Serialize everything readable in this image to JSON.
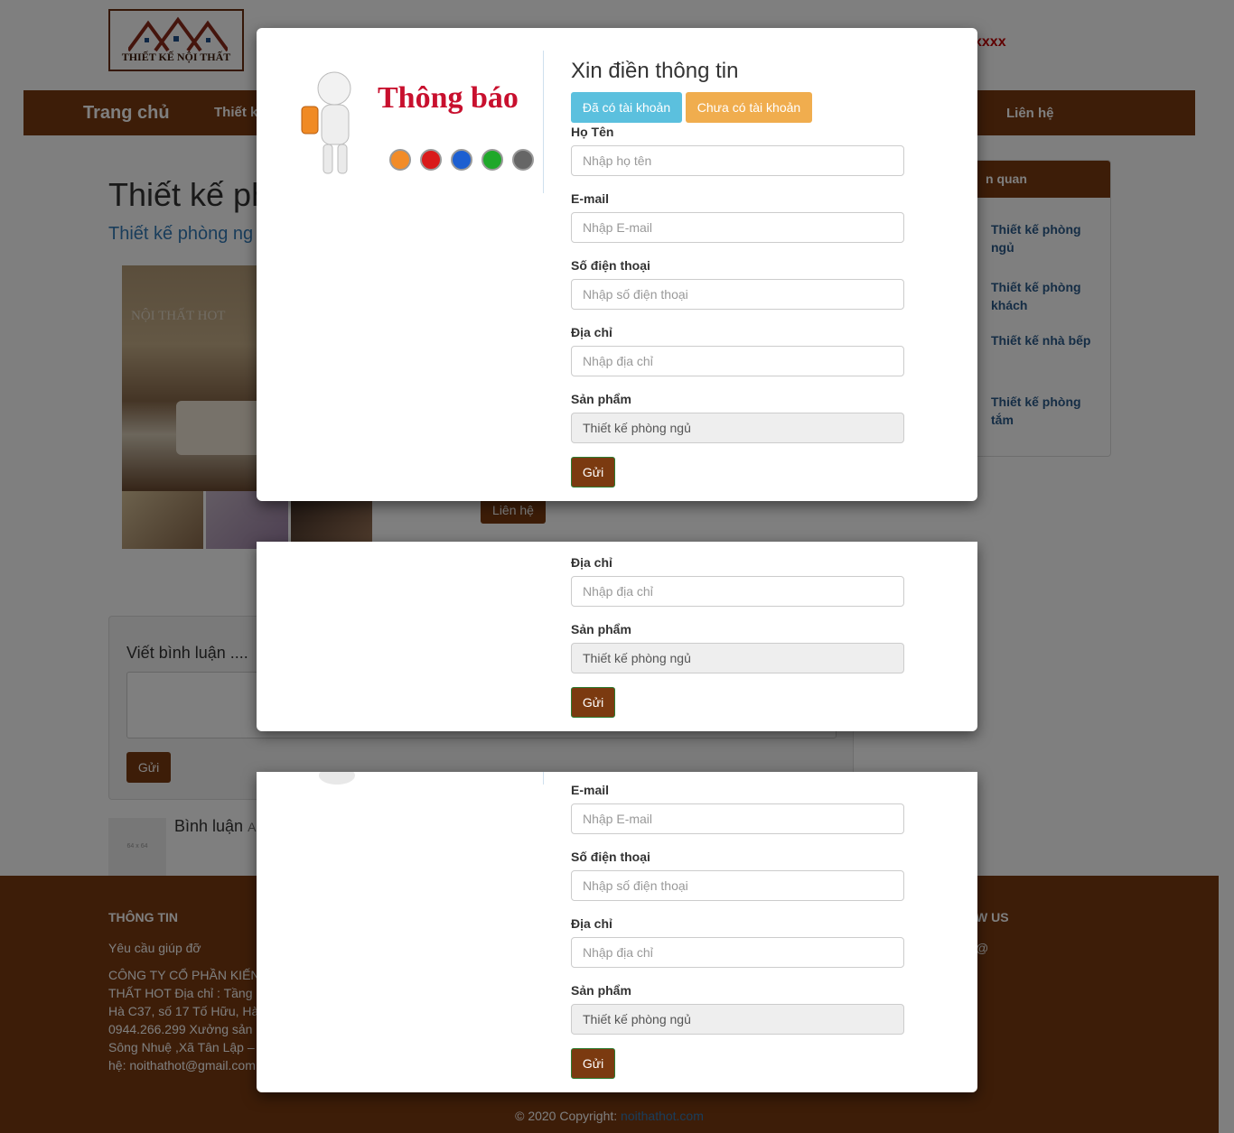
{
  "site": {
    "logo_text": "THIẾT KẾ NỘI THẤT",
    "phone_fragment": "xxxx"
  },
  "nav": {
    "home": "Trang chủ",
    "design": "Thiết k",
    "contact": "Liên hệ"
  },
  "main": {
    "title": "Thiết kế ph",
    "subtitle": "Thiết kế phòng ng",
    "watermark": "NỘI THẤT HOT",
    "contact_button": "Liên hệ"
  },
  "sidebar": {
    "header": "n quan",
    "items": [
      {
        "label": "Thiết kế phòng ngủ"
      },
      {
        "label": "Thiết kế phòng khách"
      },
      {
        "label": "Thiết kế nhà bếp"
      },
      {
        "label": "Thiết kế phòng tắm"
      }
    ]
  },
  "comments": {
    "title": "Viết bình luận ....",
    "send": "Gửi",
    "avatar_text": "64 x 64",
    "label": "Bình luận",
    "label_fragment": "A"
  },
  "footer": {
    "heading": "THÔNG TIN",
    "help": "Yêu cầu giúp đỡ",
    "company_lines": [
      "CÔNG TY CỔ PHẦN KIẾN",
      "THẤT HOT Địa chỉ : Tầng",
      "Hà C37, số 17 Tố Hữu, Hà",
      "0944.266.299 Xưởng sản",
      "Sông Nhuệ ,Xã Tân Lập –",
      "hệ: noithathot@gmail.com"
    ],
    "follow": "W US",
    "social": "@",
    "copyright": "© 2020 Copyright:",
    "copyright_link": "noithathot.com"
  },
  "modal": {
    "notice_image_text": "Thông báo",
    "title": "Xin điền thông tin",
    "tab_has_account": "Đã có tài khoản",
    "tab_no_account": "Chưa có tài khoản",
    "fields": {
      "name_label": "Họ Tên",
      "name_placeholder": "Nhập họ tên",
      "email_label": "E-mail",
      "email_placeholder": "Nhập E-mail",
      "phone_label": "Số điện thoại",
      "phone_placeholder": "Nhập số điện thoại",
      "address_label": "Địa chỉ",
      "address_placeholder": "Nhập địa chỉ",
      "product_label": "Sản phẩm",
      "product_value": "Thiết kế phòng ngủ"
    },
    "submit": "Gửi"
  },
  "colors": {
    "brand_brown": "#7b3a10",
    "info_blue": "#5bc0de",
    "warning_orange": "#f0ad4e",
    "notice_red": "#c8102e",
    "link_blue": "#337ab7"
  }
}
